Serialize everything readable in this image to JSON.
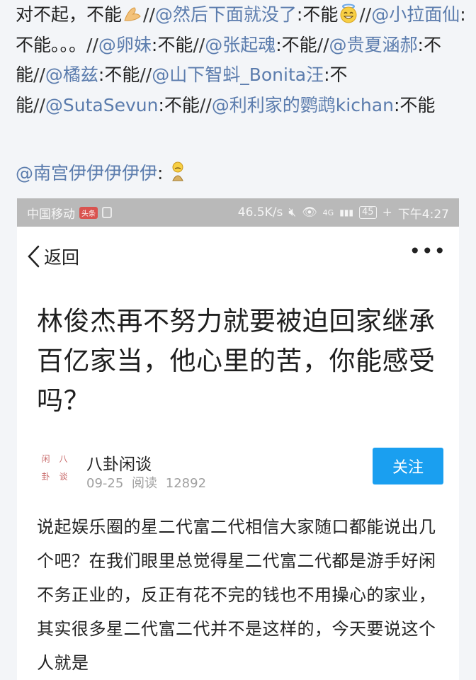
{
  "repost_chain": [
    {
      "name": "",
      "text": "对不起，不能",
      "emoji": "clasped-hands-emoji"
    },
    {
      "name": "@然后下面就没了",
      "text": "不能",
      "emoji": "grinning-halo-emoji"
    },
    {
      "name": "@小拉面仙",
      "text": "不能。。。"
    },
    {
      "name": "@卵妹",
      "text": "不能"
    },
    {
      "name": "@张起魂",
      "text": "不能"
    },
    {
      "name": "@贵夏涵郝",
      "text": "不能"
    },
    {
      "name": "@橘兹",
      "text": "不能"
    },
    {
      "name": "@山下智蚪_Bonita汪",
      "text": "不能"
    },
    {
      "name": "@SutaSevun",
      "text": "不能"
    },
    {
      "name": "@利利家的鹦鹉kichan",
      "text": "不能"
    }
  ],
  "separator": "//",
  "reply": {
    "name": "@南宫伊伊伊伊伊",
    "colon": ":",
    "emoji": "sad-kneeling-emoji"
  },
  "phone": {
    "status_bar": {
      "carrier": "中国移动",
      "carrier_badge": "头条",
      "speed": "46.5K/s",
      "network": "4G",
      "battery": "45",
      "time": "下午4:27"
    },
    "nav": {
      "back_label": "返回",
      "more_label": "•••"
    },
    "article": {
      "title": "林俊杰再不努力就要被迫回家继承百亿家当，他心里的苦，你能感受吗？",
      "author_avatar_chars": [
        "闲",
        "八",
        "卦",
        "谈"
      ],
      "author": "八卦闲谈",
      "date": "09-25",
      "read_label": "阅读",
      "read_count": "12892",
      "follow_label": "关注",
      "body": "说起娱乐圈的星二代富二代相信大家随口都能说出几个吧？在我们眼里总觉得星二代富二代都是游手好闲不务正业的，反正有花不完的钱也不用操心的家业，其实很多星二代富二代并不是这样的，今天要说这个人就是"
    }
  },
  "colors": {
    "mention": "#5b7cad",
    "follow_button": "#1a9ff0",
    "status_bar": "#b9b9b9"
  }
}
